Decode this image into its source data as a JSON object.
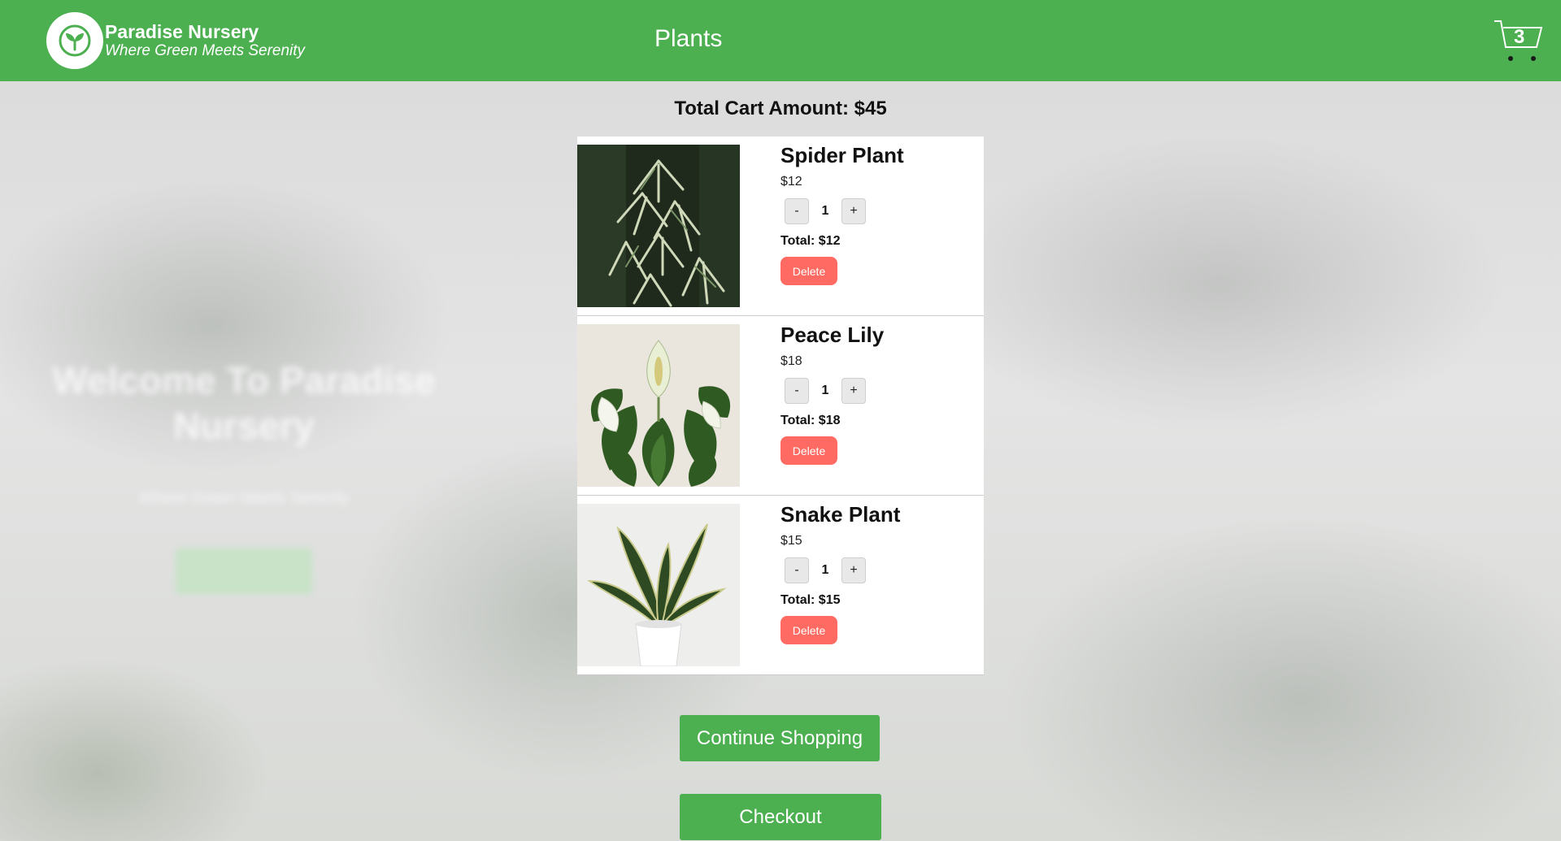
{
  "header": {
    "brand_name": "Paradise Nursery",
    "brand_tagline": "Where Green Meets Serenity",
    "nav_plants": "Plants",
    "cart_count": "3",
    "accent_color": "#4caf50"
  },
  "background": {
    "hero_title": "Welcome To Paradise Nursery",
    "hero_subtitle": "Where Green Meets Serenity"
  },
  "cart": {
    "total_label": "Total Cart Amount: $45",
    "items": [
      {
        "name": "Spider Plant",
        "price": "$12",
        "quantity": "1",
        "total": "Total: $12",
        "delete_label": "Delete",
        "decrement": "-",
        "increment": "+"
      },
      {
        "name": "Peace Lily",
        "price": "$18",
        "quantity": "1",
        "total": "Total: $18",
        "delete_label": "Delete",
        "decrement": "-",
        "increment": "+"
      },
      {
        "name": "Snake Plant",
        "price": "$15",
        "quantity": "1",
        "total": "Total: $15",
        "delete_label": "Delete",
        "decrement": "-",
        "increment": "+"
      }
    ],
    "continue_label": "Continue Shopping",
    "checkout_label": "Checkout",
    "delete_color": "#ff6b63"
  }
}
